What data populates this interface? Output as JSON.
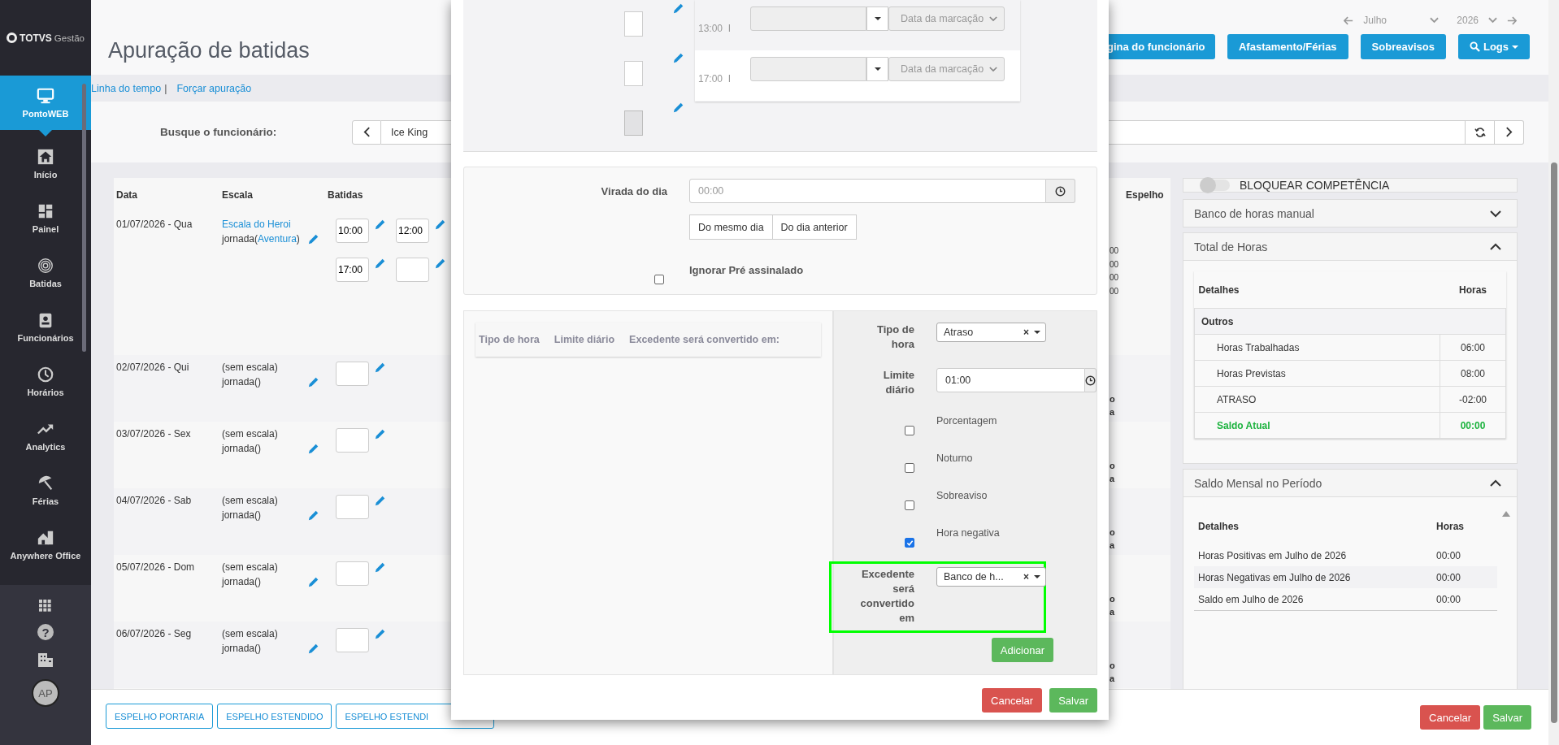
{
  "sidebar": {
    "logo": {
      "brand": "TOTVS",
      "product": "Gestão"
    },
    "items": [
      {
        "label": "PontoWEB",
        "selected": true
      },
      {
        "label": "Início",
        "selected": false
      },
      {
        "label": "Painel",
        "selected": false
      },
      {
        "label": "Batidas",
        "selected": false
      },
      {
        "label": "Funcionários",
        "selected": false
      },
      {
        "label": "Horários",
        "selected": false
      },
      {
        "label": "Analytics",
        "selected": false
      },
      {
        "label": "Férias",
        "selected": false
      },
      {
        "label": "Anywhere Office",
        "selected": false
      }
    ],
    "help": "?",
    "avatar": "AP"
  },
  "header": {
    "title": "Apuração de batidas",
    "month": "Julho",
    "year": "2026",
    "buttons": [
      {
        "label": "gina do funcionário",
        "kind": "plain"
      },
      {
        "label": "Afastamento/Férias",
        "kind": "plain"
      },
      {
        "label": "Sobreavisos",
        "kind": "plain"
      },
      {
        "label": "Logs",
        "kind": "menu"
      }
    ]
  },
  "links": {
    "items": [
      "Linha do tempo",
      "Forçar apuração"
    ],
    "separator": "|"
  },
  "search": {
    "label": "Busque o funcionário:",
    "value": "Ice King"
  },
  "table": {
    "columns": [
      "Data",
      "Escala",
      "Batidas",
      "Espelho"
    ],
    "rows": [
      {
        "date": "01/07/2026 - Qua",
        "scale": "Escala do Heroi",
        "scale_link": true,
        "journey": "jornada(",
        "journey_link": "Aventura",
        "journey_end": ")",
        "punches": [
          {
            "kind": "time",
            "value": "10:00"
          },
          {
            "kind": "time",
            "value": "12:00"
          },
          {
            "kind": "time",
            "value": "17:00"
          },
          {
            "kind": "empty"
          }
        ],
        "tail": [
          "00",
          "00",
          "00",
          "00"
        ]
      },
      {
        "date": "02/07/2026 - Qui",
        "scale": "(sem escala)",
        "scale_link": false,
        "journey": "jornada()",
        "punches": [
          {
            "kind": "empty"
          }
        ],
        "tail": [
          "o",
          "a"
        ]
      },
      {
        "date": "03/07/2026 - Sex",
        "scale": "(sem escala)",
        "scale_link": false,
        "journey": "jornada()",
        "punches": [
          {
            "kind": "empty"
          }
        ],
        "tail": [
          "o",
          "a"
        ]
      },
      {
        "date": "04/07/2026 - Sab",
        "scale": "(sem escala)",
        "scale_link": false,
        "journey": "jornada()",
        "punches": [
          {
            "kind": "empty"
          }
        ],
        "tail": [
          "o",
          "a"
        ]
      },
      {
        "date": "05/07/2026 - Dom",
        "scale": "(sem escala)",
        "scale_link": false,
        "journey": "jornada()",
        "punches": [
          {
            "kind": "empty"
          }
        ],
        "tail": [
          "o",
          "a"
        ]
      },
      {
        "date": "06/07/2026 - Seg",
        "scale": "(sem escala)",
        "scale_link": false,
        "journey": "jornada()",
        "punches": [
          {
            "kind": "empty"
          }
        ],
        "tail": [
          "o",
          "a"
        ]
      }
    ]
  },
  "right": {
    "toggle": {
      "label": "BLOQUEAR COMPETÊNCIA",
      "on": false
    },
    "panels": [
      {
        "title": "Banco de horas manual",
        "expanded": false
      },
      {
        "title": "Total de Horas",
        "expanded": true,
        "table": {
          "columns": [
            "Detalhes",
            "Horas"
          ],
          "group": "Outros",
          "rows": [
            {
              "label": "Horas Trabalhadas",
              "value": "06:00",
              "kind": "item"
            },
            {
              "label": "Horas Previstas",
              "value": "08:00",
              "kind": "item"
            },
            {
              "label": "ATRASO",
              "value": "-02:00",
              "kind": "item"
            },
            {
              "label": "Saldo Atual",
              "value": "00:00",
              "kind": "total"
            }
          ]
        }
      },
      {
        "title": "Saldo Mensal no Período",
        "expanded": true,
        "table": {
          "columns": [
            "Detalhes",
            "Horas"
          ],
          "rows": [
            {
              "label": "Horas Positivas em Julho de 2026",
              "value": "00:00",
              "kind": "item"
            },
            {
              "label": "Horas Negativas em Julho de 2026",
              "value": "00:00",
              "kind": "item"
            },
            {
              "label": "Saldo em Julho de 2026",
              "value": "00:00",
              "kind": "item"
            }
          ]
        }
      }
    ]
  },
  "bottom_bar": {
    "buttons": [
      "ESPELHO PORTARIA",
      "ESPELHO ESTENDIDO",
      "ESPELHO ESTENDI"
    ],
    "actions": [
      {
        "label": "Cancelar",
        "kind": "danger"
      },
      {
        "label": "Salvar",
        "kind": "success"
      }
    ]
  },
  "modal": {
    "mark_inputs": [
      {
        "disabled": false
      },
      {
        "disabled": false
      },
      {
        "disabled": true
      }
    ],
    "marks": [
      {
        "time": "13:00",
        "separator": "I",
        "placeholder": "Data da marcação",
        "disabled": true
      },
      {
        "time": "17:00",
        "separator": "I",
        "placeholder": "Data da marcação",
        "disabled": true
      }
    ],
    "turnover": {
      "label": "Virada do dia",
      "placeholder": "00:00",
      "options": [
        "Do mesmo dia",
        "Do dia anterior"
      ]
    },
    "ignore": {
      "label": "Ignorar Pré assinalado",
      "checked": false
    },
    "rules": {
      "columns": [
        "Tipo de hora",
        "Limite diário",
        "Excedente será convertido em:"
      ],
      "form": {
        "type_label": "Tipo de hora",
        "type_value": "Atraso",
        "limit_label": "Limite diário",
        "limit_value": "01:00",
        "clear": "×",
        "options": [
          {
            "label": "Porcentagem",
            "checked": false
          },
          {
            "label": "Noturno",
            "checked": false
          },
          {
            "label": "Sobreaviso",
            "checked": false
          },
          {
            "label": "Hora negativa",
            "checked": true
          }
        ],
        "convert_label": "Excedente será convertido em",
        "convert_value": "Banco de h...",
        "highlighted": true,
        "add": "Adicionar"
      }
    },
    "actions": [
      {
        "label": "Cancelar",
        "kind": "danger"
      },
      {
        "label": "Salvar",
        "kind": "success"
      }
    ]
  }
}
